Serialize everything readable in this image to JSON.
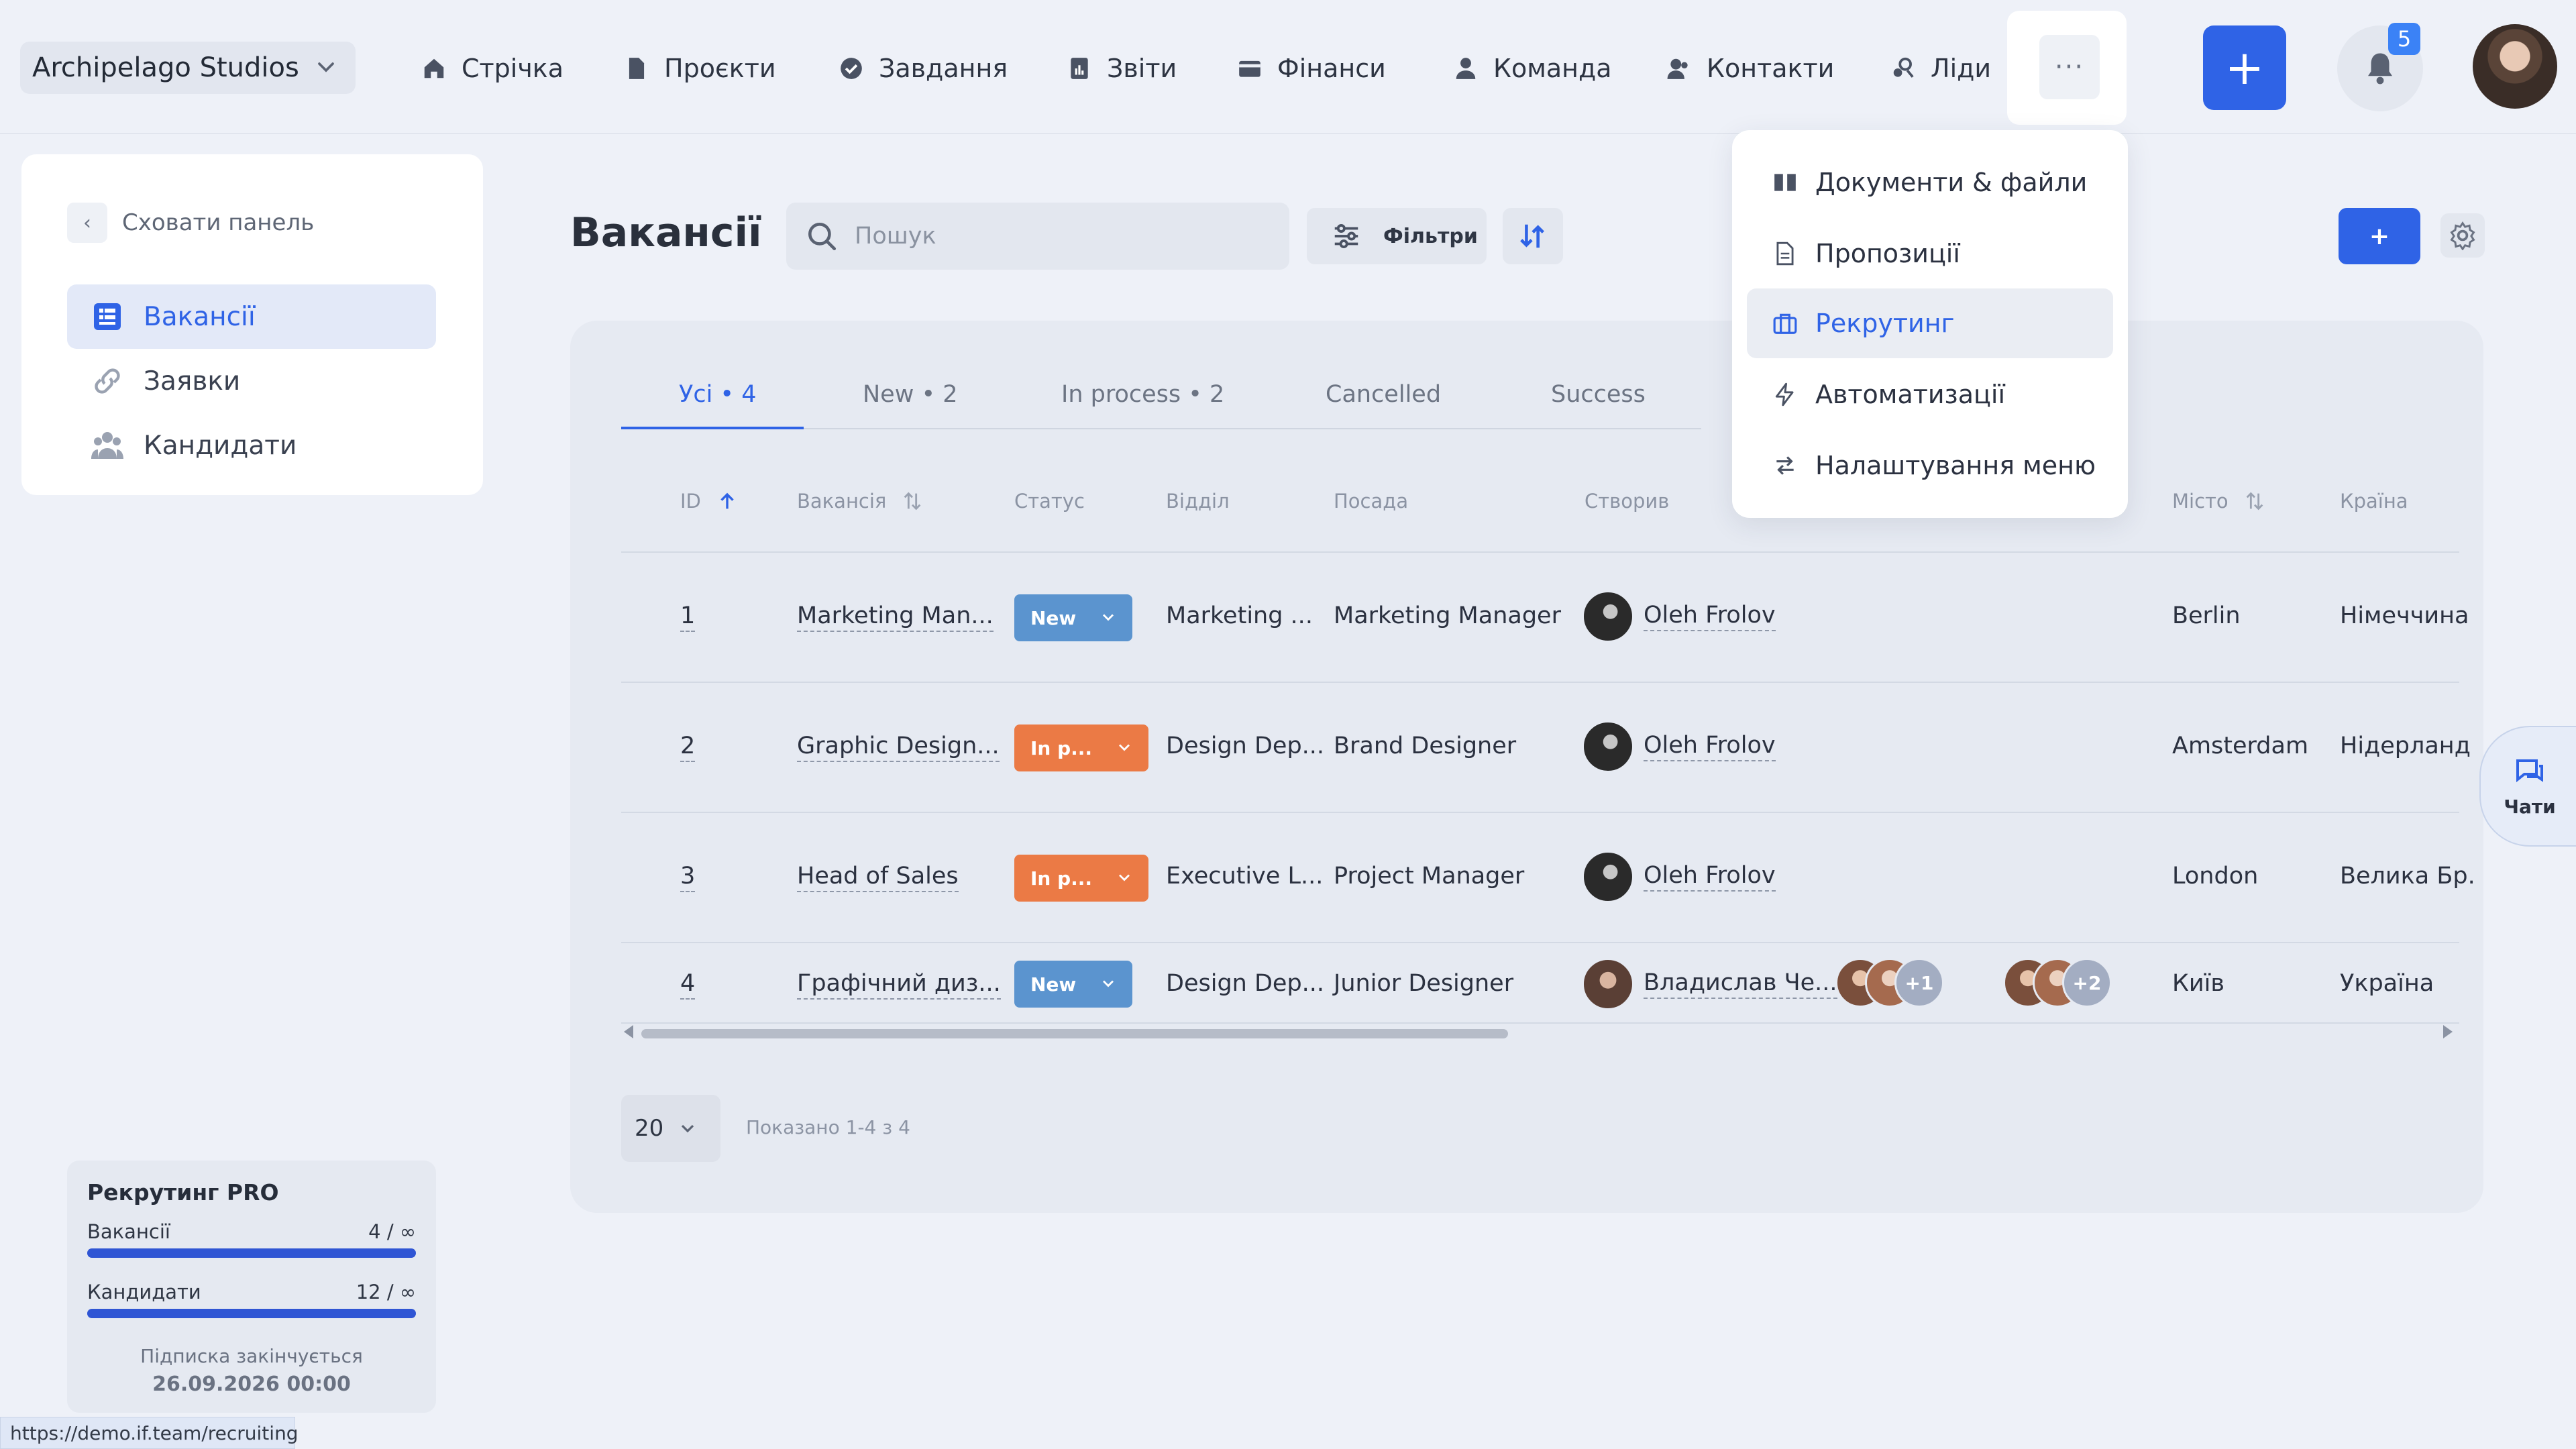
{
  "header": {
    "company": "Archipelago Studios",
    "nav": [
      {
        "label": "Стрічка",
        "icon": "home-icon"
      },
      {
        "label": "Проєкти",
        "icon": "file-icon"
      },
      {
        "label": "Завдання",
        "icon": "check-circle-icon"
      },
      {
        "label": "Звіти",
        "icon": "report-icon"
      },
      {
        "label": "Фінанси",
        "icon": "wallet-icon"
      },
      {
        "label": "Команда",
        "icon": "user-icon"
      },
      {
        "label": "Контакти",
        "icon": "contacts-icon"
      },
      {
        "label": "Ліди",
        "icon": "leads-icon"
      }
    ],
    "more_label": "···",
    "add_label": "+",
    "notifications_count": "5"
  },
  "sidebar": {
    "hide_label": "Сховати панель",
    "items": [
      {
        "label": "Вакансії",
        "active": true
      },
      {
        "label": "Заявки",
        "active": false
      },
      {
        "label": "Кандидати",
        "active": false
      }
    ],
    "plan": {
      "title": "Рекрутинг PRO",
      "rows": [
        {
          "label": "Вакансії",
          "value": "4 / ∞",
          "fill": 1.0
        },
        {
          "label": "Кандидати",
          "value": "12 / ∞",
          "fill": 1.0
        }
      ],
      "expires_label": "Підписка закінчується",
      "expires_date": "26.09.2026 00:00"
    }
  },
  "main": {
    "title": "Вакансії",
    "search_placeholder": "Пошук",
    "filters_label": "Фільтри",
    "add_label": "+",
    "tabs": [
      {
        "label": "Усі • 4",
        "active": true
      },
      {
        "label": "New • 2",
        "active": false
      },
      {
        "label": "In process • 2",
        "active": false
      },
      {
        "label": "Cancelled",
        "active": false
      },
      {
        "label": "Success",
        "active": false
      }
    ],
    "columns": [
      "ID",
      "Вакансія",
      "Статус",
      "Відділ",
      "Посада",
      "Створив",
      "Місто",
      "Країна"
    ],
    "rows": [
      {
        "id": "1",
        "vacancy": "Marketing Man...",
        "status": "New",
        "department": "Marketing ...",
        "position": "Marketing Manager",
        "creator": "Oleh Frolov",
        "city": "Berlin",
        "country": "Німеччина"
      },
      {
        "id": "2",
        "vacancy": "Graphic Design...",
        "status": "In p...",
        "department": "Design Dep...",
        "position": "Brand Designer",
        "creator": "Oleh Frolov",
        "city": "Amsterdam",
        "country": "Нідерланд"
      },
      {
        "id": "3",
        "vacancy": "Head of Sales",
        "status": "In p...",
        "department": "Executive L...",
        "position": "Project Manager",
        "creator": "Oleh Frolov",
        "city": "London",
        "country": "Велика Бр."
      },
      {
        "id": "4",
        "vacancy": "Графічний диз...",
        "status": "New",
        "department": "Design Dep...",
        "position": "Junior Designer",
        "creator": "Владислав Че...",
        "extra1": "+1",
        "extra2": "+2",
        "city": "Київ",
        "country": "Україна"
      }
    ],
    "page_size": "20",
    "shown_text": "Показано 1-4 з 4"
  },
  "menu": {
    "items": [
      {
        "label": "Документи & файли",
        "active": false
      },
      {
        "label": "Пропозиції",
        "active": false
      },
      {
        "label": "Рекрутинг",
        "active": true
      },
      {
        "label": "Автоматизації",
        "active": false
      },
      {
        "label": "Налаштування меню",
        "active": false
      }
    ]
  },
  "chat_label": "Чати",
  "status_url": "https://demo.if.team/recruiting",
  "colors": {
    "accent": "#2f63e6",
    "status_new": "#5b94cf",
    "status_in_process": "#eb7a45"
  }
}
